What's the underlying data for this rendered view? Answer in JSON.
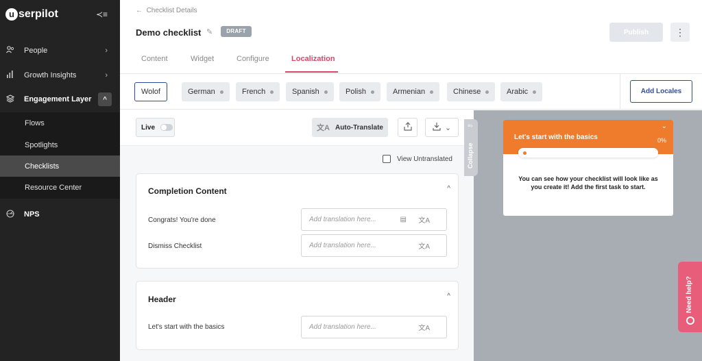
{
  "app": {
    "logo_initial": "u",
    "logo_rest": "serpilot",
    "collapse_icon": "≺≡"
  },
  "sidebar": {
    "items": [
      {
        "label": "People",
        "icon": "people-icon"
      },
      {
        "label": "Growth Insights",
        "icon": "bar-chart-icon"
      },
      {
        "label": "Engagement Layer",
        "icon": "layers-icon"
      },
      {
        "label": "NPS",
        "icon": "gauge-icon"
      }
    ],
    "subitems": [
      "Flows",
      "Spotlights",
      "Checklists",
      "Resource Center"
    ],
    "active_subitem": "Checklists"
  },
  "header": {
    "back_label": "Checklist Details",
    "title": "Demo checklist",
    "status": "DRAFT",
    "publish_label": "Publish",
    "tabs": [
      "Content",
      "Widget",
      "Configure",
      "Localization"
    ],
    "active_tab": "Localization"
  },
  "locales": {
    "chips": [
      "Wolof",
      "German",
      "French",
      "Spanish",
      "Polish",
      "Armenian",
      "Chinese",
      "Arabic"
    ],
    "selected": "Wolof",
    "add_label": "Add Locales"
  },
  "toolbar": {
    "live_label": "Live",
    "live_on": false,
    "auto_translate_label": "Auto-Translate",
    "view_untranslated_label": "View Untranslated"
  },
  "cards": [
    {
      "title": "Completion Content",
      "rows": [
        {
          "label": "Congrats! You're done",
          "placeholder": "Add translation here..."
        },
        {
          "label": "Dismiss Checklist",
          "placeholder": "Add translation here..."
        }
      ]
    },
    {
      "title": "Header",
      "rows": [
        {
          "label": "Let's start with the basics",
          "placeholder": "Add translation here..."
        }
      ]
    }
  ],
  "preview": {
    "collapse_label": "Collapse",
    "widget_title": "Let's start with the basics",
    "progress_percent": "0%",
    "body": "You can see how your checklist will look like as you create it! Add the first task to start.",
    "accent_color": "#ef7b2c"
  },
  "help": {
    "label": "Need help?",
    "color": "#e85d7a"
  }
}
